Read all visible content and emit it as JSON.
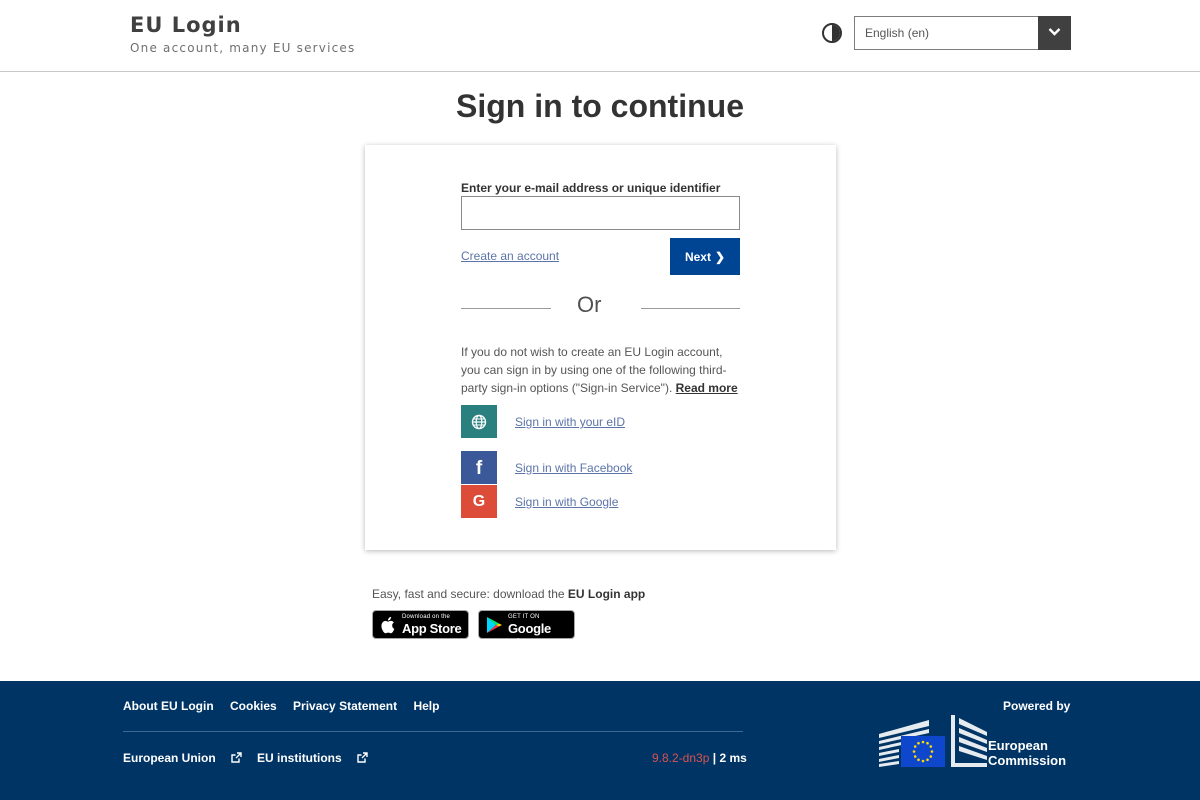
{
  "header": {
    "title": "EU Login",
    "subtitle": "One account, many EU services",
    "contrast_icon": "contrast-icon",
    "language": "English (en)"
  },
  "main": {
    "title": "Sign in to continue",
    "email_label": "Enter your e-mail address or unique identifier",
    "email_value": "",
    "create_account": "Create an account",
    "next_label": "Next",
    "or": "Or",
    "info_text": "If you do not wish to create an EU Login account, you can sign in by using one of the following third-party sign-in options (\"Sign-in Service\").",
    "read_more": "Read more",
    "sso": [
      {
        "label": "Sign in with your eID",
        "icon": "globe-icon",
        "color": "#2a7f7f"
      },
      {
        "label": "Sign in with Facebook",
        "icon": "facebook-icon",
        "color": "#3b5998"
      },
      {
        "label": "Sign in with Google",
        "icon": "google-icon",
        "color": "#dd4b39"
      }
    ]
  },
  "app": {
    "text": "Easy, fast and secure: download the ",
    "app_name": "EU Login app",
    "appstore_small": "Download on the",
    "appstore_big": "App Store",
    "googleplay_small": "GET IT ON",
    "googleplay_big": "Google Play"
  },
  "footer": {
    "links": [
      "About EU Login",
      "Cookies",
      "Privacy Statement",
      "Help"
    ],
    "external_links": [
      "European Union",
      "EU institutions"
    ],
    "version": "9.8.2-dn3p",
    "timing": "2 ms",
    "powered_by": "Powered by",
    "org_line1": "European",
    "org_line2": "Commission",
    "colors": {
      "footer_bg": "#003465",
      "primary": "#004494"
    }
  }
}
